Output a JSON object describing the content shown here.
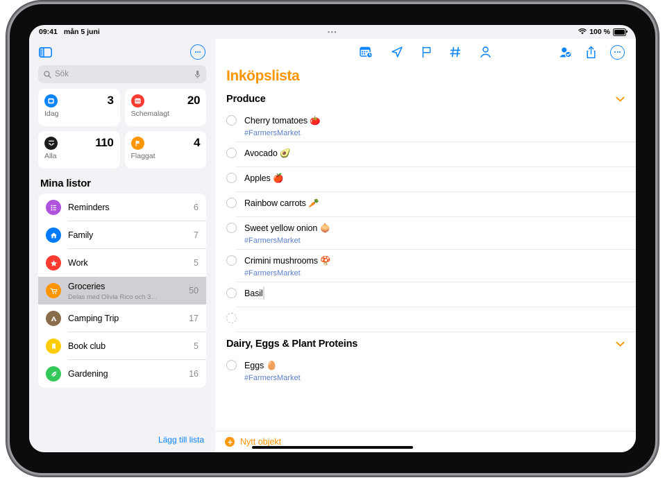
{
  "statusbar": {
    "time": "09:41",
    "date": "mån 5 juni",
    "wifi_icon": "wifi-icon",
    "battery_text": "100 %",
    "grabber": "•••"
  },
  "sidebar": {
    "toggle_icon": "sidebar-toggle-icon",
    "more_icon": "more-circle-icon",
    "search": {
      "placeholder": "Sök",
      "search_icon": "search-icon",
      "mic_icon": "microphone-icon"
    },
    "cards": [
      {
        "icon": "today-calendar-icon",
        "count": "3",
        "label": "Idag",
        "color": "#0a84ff"
      },
      {
        "icon": "scheduled-calendar-icon",
        "count": "20",
        "label": "Schemalagt",
        "color": "#ff3b30"
      },
      {
        "icon": "all-inbox-icon",
        "count": "110",
        "label": "Alla",
        "color": "#1c1c1e"
      },
      {
        "icon": "flag-icon",
        "count": "4",
        "label": "Flaggat",
        "color": "#ff9500"
      }
    ],
    "mylists_title": "Mina listor",
    "lists": [
      {
        "name": "Reminders",
        "count": "6",
        "icon": "bulleted-list-icon",
        "color": "#af52de",
        "sub": ""
      },
      {
        "name": "Family",
        "count": "7",
        "icon": "house-icon",
        "color": "#007aff",
        "sub": ""
      },
      {
        "name": "Work",
        "count": "5",
        "icon": "star-icon",
        "color": "#ff3b30",
        "sub": ""
      },
      {
        "name": "Groceries",
        "count": "50",
        "icon": "shopping-cart-icon",
        "color": "#ff9500",
        "sub": "Delas med Olivia Rico och 3…"
      },
      {
        "name": "Camping Trip",
        "count": "17",
        "icon": "tent-icon",
        "color": "#8a6d4b",
        "sub": ""
      },
      {
        "name": "Book club",
        "count": "5",
        "icon": "bookmark-icon",
        "color": "#ffcc00",
        "sub": ""
      },
      {
        "name": "Gardening",
        "count": "16",
        "icon": "leaf-icon",
        "color": "#34c759",
        "sub": ""
      }
    ],
    "add_list_label": "Lägg till lista"
  },
  "content": {
    "toolbar_center": [
      {
        "icon": "calendar-clock-icon",
        "name": "add-date-button"
      },
      {
        "icon": "location-arrow-icon",
        "name": "add-location-button"
      },
      {
        "icon": "flag-icon",
        "name": "flag-button"
      },
      {
        "icon": "hashtag-icon",
        "name": "tag-button"
      },
      {
        "icon": "person-icon",
        "name": "assign-person-button"
      }
    ],
    "toolbar_right": [
      {
        "icon": "share-participants-icon",
        "name": "collaboration-button"
      },
      {
        "icon": "share-icon",
        "name": "share-button"
      },
      {
        "icon": "more-circle-icon",
        "name": "more-button"
      }
    ],
    "title": "Inköpslista",
    "sections": [
      {
        "name": "Produce",
        "chevron": "chevron-down-icon",
        "items": [
          {
            "title": "Cherry tomatoes 🍅",
            "tag": "#FarmersMarket",
            "thumb": false
          },
          {
            "title": "Avocado 🥑",
            "tag": "",
            "thumb": false
          },
          {
            "title": "Apples 🍎",
            "tag": "",
            "thumb": false
          },
          {
            "title": "Rainbow carrots 🥕",
            "tag": "",
            "thumb": false
          },
          {
            "title": "Sweet yellow onion 🧅",
            "tag": "#FarmersMarket",
            "thumb": false
          },
          {
            "title": "Crimini mushrooms 🍄",
            "tag": "#FarmersMarket",
            "thumb": false
          },
          {
            "title": "Basil",
            "tag": "",
            "thumb": true
          },
          {
            "title": "",
            "tag": "",
            "thumb": false
          }
        ]
      },
      {
        "name": "Dairy, Eggs & Plant Proteins",
        "chevron": "chevron-down-icon",
        "items": [
          {
            "title": "Eggs 🥚",
            "tag": "#FarmersMarket",
            "thumb": false
          }
        ]
      }
    ],
    "new_item": {
      "icon": "plus-circle-icon",
      "label": "Nytt objekt"
    }
  },
  "colors": {
    "accent_orange": "#ff9500",
    "accent_blue": "#0a84ff",
    "tag_blue": "#5b7fc7",
    "selected_row": "#cfcfd4"
  }
}
